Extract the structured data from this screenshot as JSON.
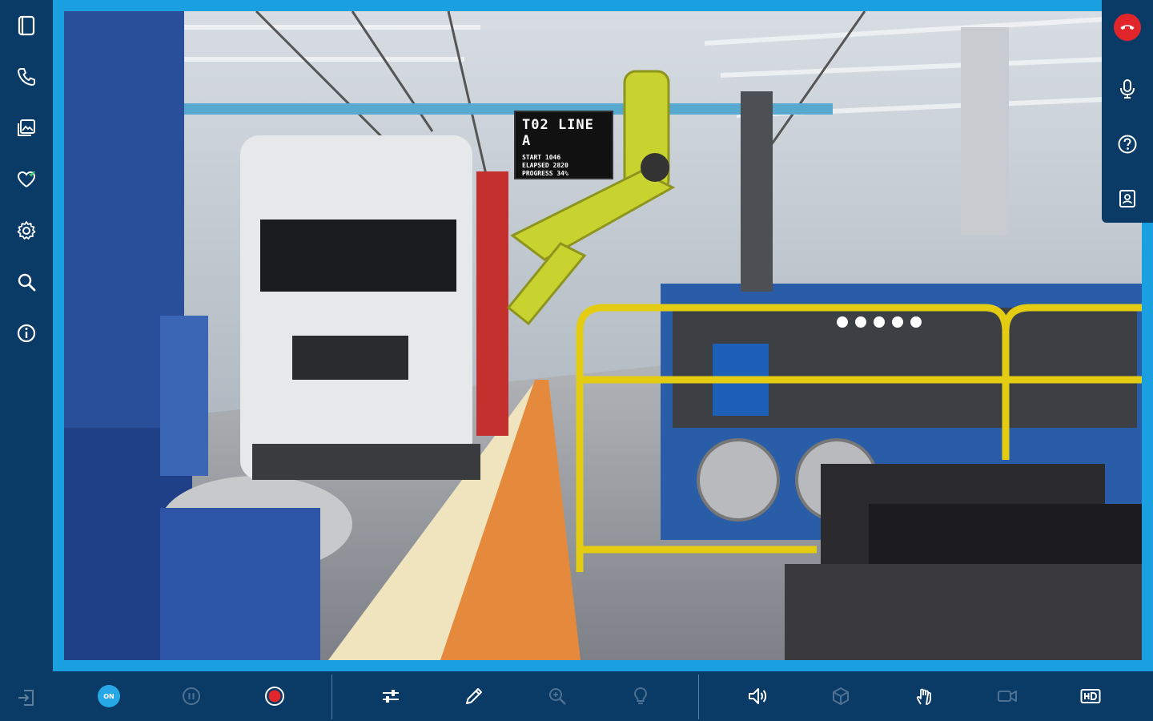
{
  "scene": {
    "sign_title": "T02  LINE A",
    "sign_lines": [
      "START 1046",
      "ELAPSED 2820",
      "PROGRESS 34%"
    ]
  },
  "sidebar": {
    "items": [
      {
        "icon": "panel-icon"
      },
      {
        "icon": "phone-icon"
      },
      {
        "icon": "gallery-icon"
      },
      {
        "icon": "heart-check-icon"
      },
      {
        "icon": "gear-icon"
      },
      {
        "icon": "search-icon"
      },
      {
        "icon": "info-icon"
      }
    ],
    "exit_icon": "exit-icon"
  },
  "call_panel": {
    "buttons": [
      "hangup-icon",
      "microphone-icon",
      "help-icon",
      "contact-card-icon"
    ],
    "hangup_color": "#e1262b"
  },
  "toolbar": {
    "on_badge": "ON",
    "buttons": [
      "on-toggle",
      "pause",
      "record",
      "adjust",
      "pencil",
      "zoom",
      "bulb",
      "speaker",
      "cube",
      "hand-gesture",
      "video",
      "hd"
    ],
    "accent": "#27a8e6",
    "record_color": "#e1262b"
  },
  "colors": {
    "background": "#0a3a66",
    "frame": "#1a9fe0"
  }
}
